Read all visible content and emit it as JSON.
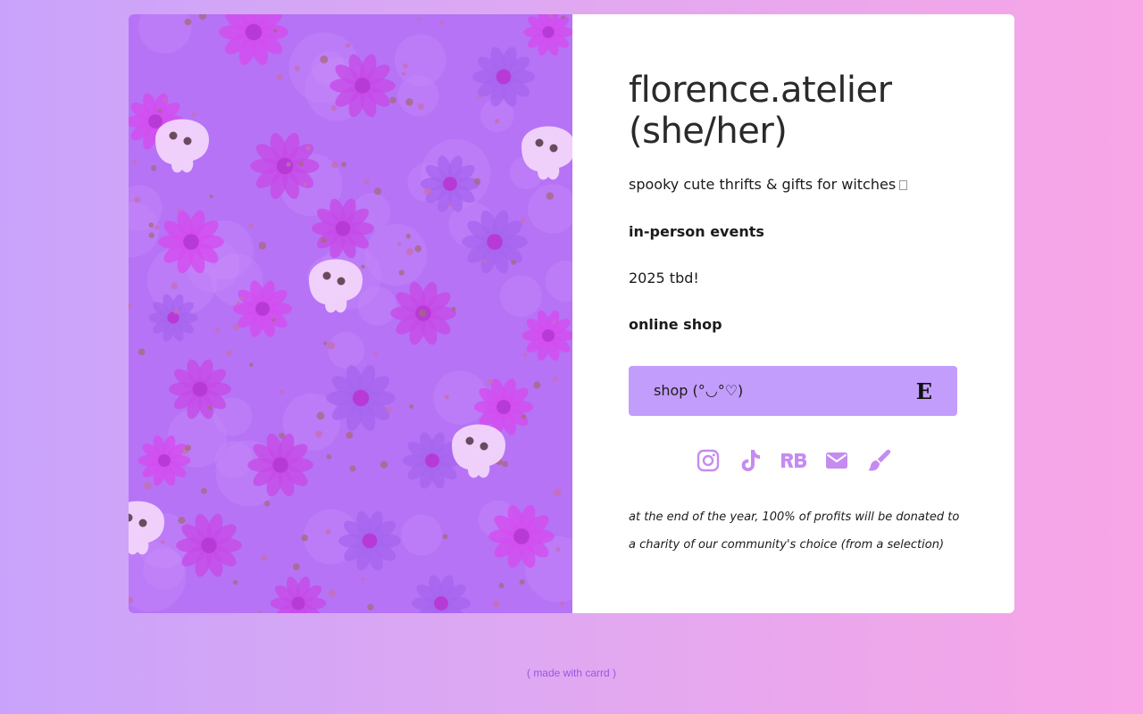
{
  "profile": {
    "title_line1": "florence.atelier",
    "title_line2": "(she/her)",
    "tagline": "spooky cute thrifts & gifts for witches"
  },
  "events": {
    "heading": "in-person events",
    "text": "2025 tbd!"
  },
  "shop": {
    "heading": "online shop",
    "button_label": "shop (°◡°♡)",
    "button_icon": "E"
  },
  "socials": [
    "instagram-icon",
    "tiktok-icon",
    "redbubble-icon",
    "email-icon",
    "paintbrush-icon"
  ],
  "note": "at the end of the year, 100% of profits will be donated to a charity of our community's choice (from a selection)",
  "footer": "( made with carrd )",
  "colors": {
    "background_start": "#c9a3fb",
    "background_end": "#f8a6e6",
    "button": "#c39dfc",
    "icon": "#c58cf0",
    "footer_link": "#9a56e3"
  }
}
